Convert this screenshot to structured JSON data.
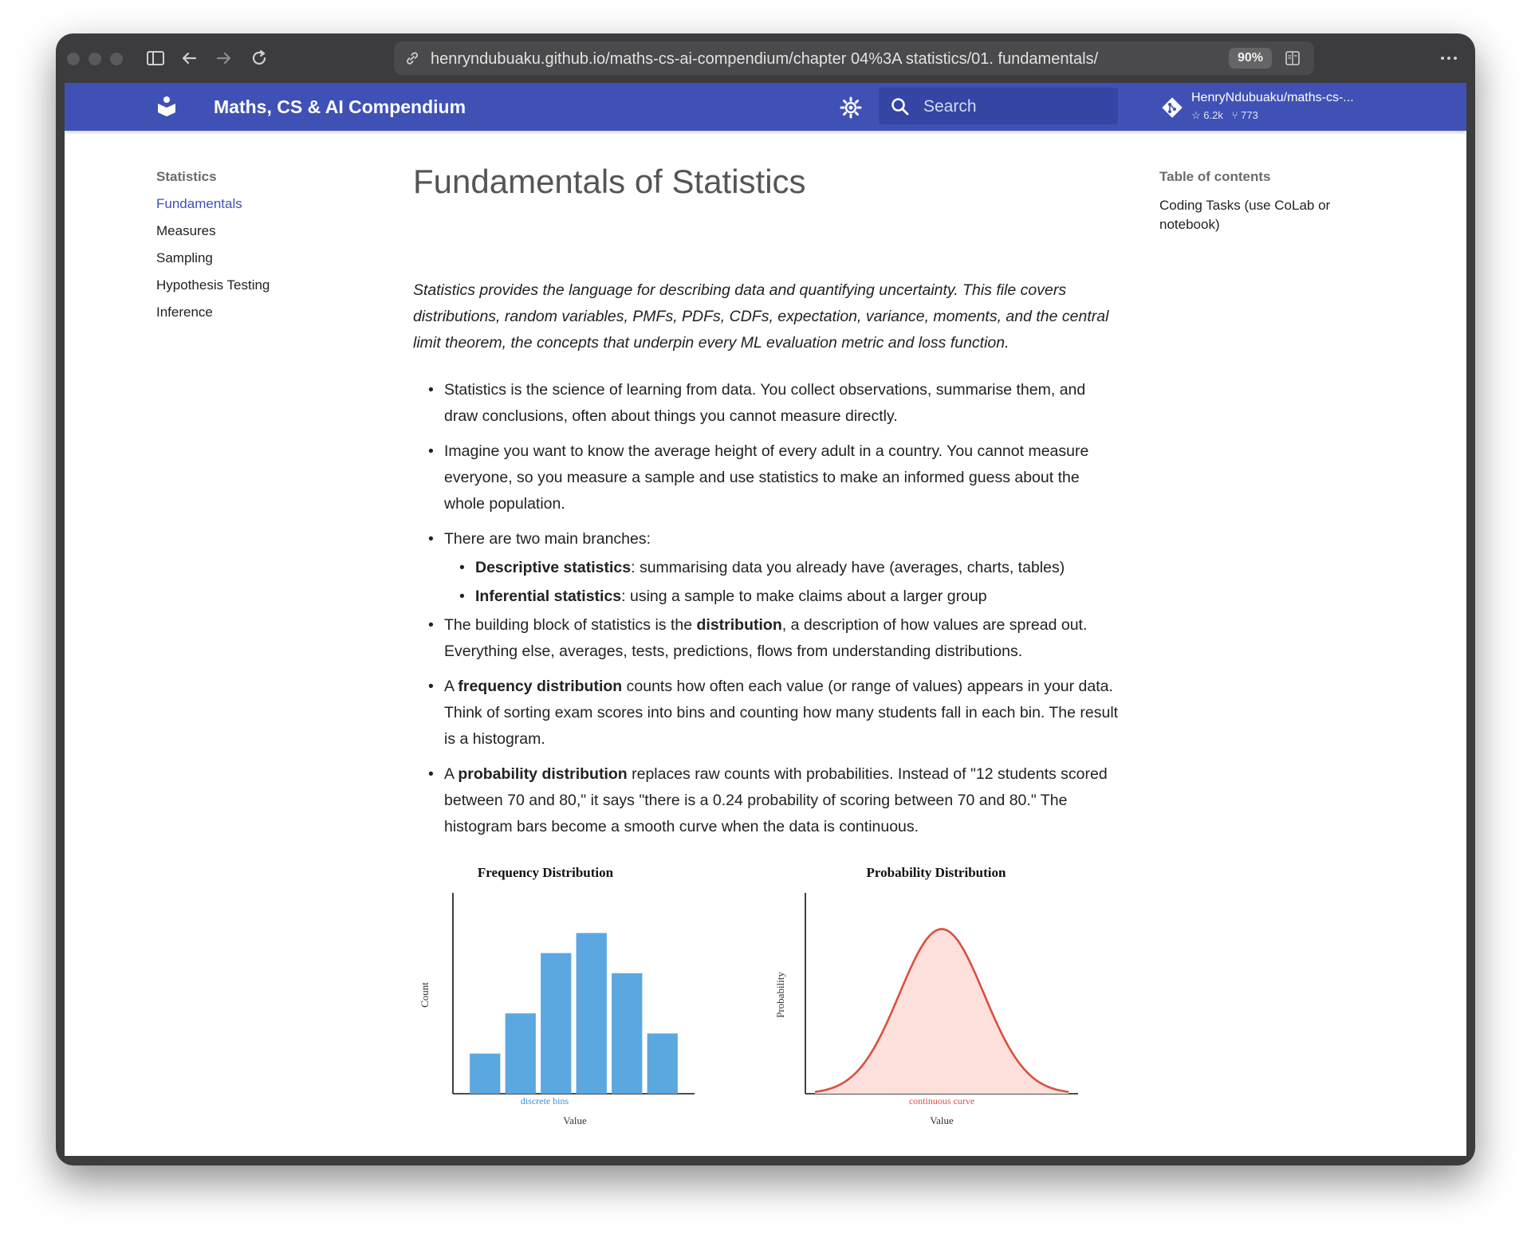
{
  "browser": {
    "url": "henryndubuaku.github.io/maths-cs-ai-compendium/chapter 04%3A statistics/01. fundamentals/",
    "zoom": "90%"
  },
  "header": {
    "site_title": "Maths, CS & AI Compendium",
    "search_placeholder": "Search",
    "repo_name": "HenryNdubuaku/maths-cs-...",
    "repo_stars": "6.2k",
    "repo_forks": "773"
  },
  "sidebar": {
    "title": "Statistics",
    "items": [
      {
        "label": "Fundamentals",
        "active": true
      },
      {
        "label": "Measures",
        "active": false
      },
      {
        "label": "Sampling",
        "active": false
      },
      {
        "label": "Hypothesis Testing",
        "active": false
      },
      {
        "label": "Inference",
        "active": false
      }
    ]
  },
  "toc": {
    "title": "Table of contents",
    "items": [
      "Coding Tasks (use CoLab or notebook)"
    ]
  },
  "main": {
    "title": "Fundamentals of Statistics",
    "intro": "Statistics provides the language for describing data and quantifying uncertainty. This file covers distributions, random variables, PMFs, PDFs, CDFs, expectation, variance, moments, and the central limit theorem, the concepts that underpin every ML evaluation metric and loss function.",
    "b1": "Statistics is the science of learning from data. You collect observations, summarise them, and draw conclusions, often about things you cannot measure directly.",
    "b2": "Imagine you want to know the average height of every adult in a country. You cannot measure everyone, so you measure a sample and use statistics to make an informed guess about the whole population.",
    "b3": "There are two main branches:",
    "b3a_bold": "Descriptive statistics",
    "b3a_rest": ": summarising data you already have (averages, charts, tables)",
    "b3b_bold": "Inferential statistics",
    "b3b_rest": ": using a sample to make claims about a larger group",
    "b4_pre": "The building block of statistics is the ",
    "b4_bold": "distribution",
    "b4_rest": ", a description of how values are spread out. Everything else, averages, tests, predictions, flows from understanding distributions.",
    "b5_pre": "A ",
    "b5_bold": "frequency distribution",
    "b5_rest": " counts how often each value (or range of values) appears in your data. Think of sorting exam scores into bins and counting how many students fall in each bin. The result is a histogram.",
    "b6_pre": "A ",
    "b6_bold": "probability distribution",
    "b6_rest": " replaces raw counts with probabilities. Instead of \"12 students scored between 70 and 80,\" it says \"there is a 0.24 probability of scoring between 70 and 80.\" The histogram bars become a smooth curve when the data is continuous."
  },
  "chart_data": [
    {
      "type": "bar",
      "title": "Frequency Distribution",
      "xlabel": "Value",
      "ylabel": "Count",
      "annotation": "discrete bins",
      "values": [
        2,
        4,
        7,
        8,
        6,
        3
      ],
      "ylim": [
        0,
        10
      ],
      "color": "#5ba7e0"
    },
    {
      "type": "area",
      "title": "Probability Distribution",
      "xlabel": "Value",
      "ylabel": "Probability",
      "annotation": "continuous curve",
      "x": [
        -3,
        -2.5,
        -2,
        -1.5,
        -1,
        -0.5,
        0,
        0.5,
        1,
        1.5,
        2,
        2.5,
        3
      ],
      "y": [
        0.011,
        0.044,
        0.135,
        0.325,
        0.607,
        0.882,
        1.0,
        0.882,
        0.607,
        0.325,
        0.135,
        0.044,
        0.011
      ],
      "ylim": [
        0,
        1.22
      ],
      "line_color": "#d9503f",
      "fill_color": "#fde0dc"
    }
  ]
}
